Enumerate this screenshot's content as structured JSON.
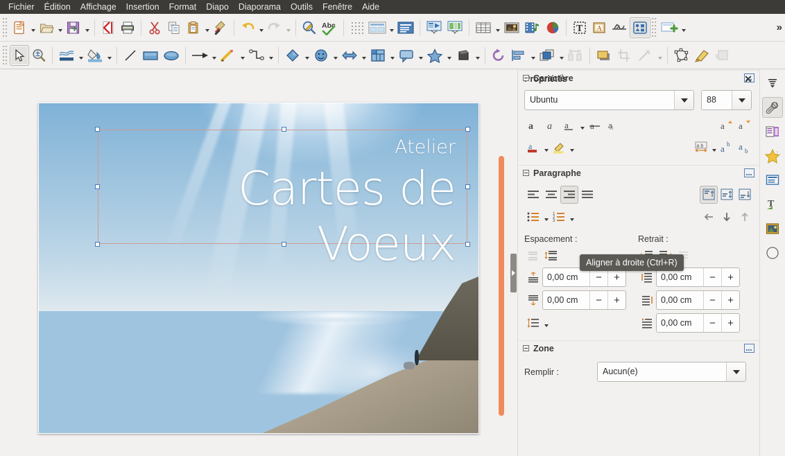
{
  "app": {
    "suite": "LibreOffice Impress"
  },
  "menubar": {
    "items": [
      {
        "label": "Fichier",
        "name": "menu-fichier"
      },
      {
        "label": "Édition",
        "name": "menu-edition"
      },
      {
        "label": "Affichage",
        "name": "menu-affichage"
      },
      {
        "label": "Insertion",
        "name": "menu-insertion"
      },
      {
        "label": "Format",
        "name": "menu-format"
      },
      {
        "label": "Diapo",
        "name": "menu-diapo"
      },
      {
        "label": "Diaporama",
        "name": "menu-diaporama"
      },
      {
        "label": "Outils",
        "name": "menu-outils"
      },
      {
        "label": "Fenêtre",
        "name": "menu-fenetre"
      },
      {
        "label": "Aide",
        "name": "menu-aide"
      }
    ]
  },
  "toolbar_standard": {
    "overflow_label": "»",
    "items": [
      "new-document-icon",
      "open-document-icon",
      "save-document-icon",
      "export-pdf-icon",
      "print-icon",
      "cut-icon",
      "copy-icon",
      "paste-icon",
      "clone-formatting-icon",
      "undo-icon",
      "redo-icon",
      "find-replace-icon",
      "spelling-icon",
      "display-grid-icon",
      "master-slide-icon",
      "slide-layout-icon",
      "start-from-first-slide-icon",
      "start-from-current-slide-icon",
      "insert-table-icon",
      "insert-image-icon",
      "insert-media-icon",
      "insert-chart-icon",
      "insert-text-box-icon",
      "insert-fontwork-icon",
      "insert-special-character-icon",
      "show-draw-functions-icon",
      "new-slide-icon"
    ]
  },
  "toolbar_drawing": {
    "items": [
      "select-icon",
      "zoom-icon",
      "line-color-icon",
      "fill-color-icon",
      "insert-line-icon",
      "rectangle-icon",
      "ellipse-icon",
      "line-ends-arrow-icon",
      "curves-and-polygons-icon",
      "connectors-icon",
      "basic-shapes-icon",
      "symbol-shapes-icon",
      "block-arrows-icon",
      "flowchart-shapes-icon",
      "callout-shapes-icon",
      "stars-shapes-icon",
      "3d-objects-icon",
      "rotate-icon",
      "align-objects-icon",
      "arrange-icon",
      "distribute-icon",
      "shadow-icon",
      "crop-image-icon",
      "filter-icon",
      "points-icon",
      "glue-points-icon",
      "to-curve-icon"
    ]
  },
  "slide": {
    "textbox": {
      "line1": "Atelier",
      "line2": "Cartes de Voeux",
      "alignment": "right",
      "selected": true
    },
    "background_image": "seascape-photo"
  },
  "sidebar": {
    "title": "Propriétés",
    "close_label": "✕",
    "sections": {
      "character": {
        "title": "Caractère",
        "font_name": "Ubuntu",
        "font_size": "88",
        "buttons": [
          "bold-icon",
          "italic-icon",
          "underline-icon",
          "strikethrough-icon",
          "shadow-icon",
          "increase-font-size-icon",
          "decrease-font-size-icon",
          "font-color-icon",
          "highlighting-color-icon",
          "character-spacing-icon",
          "superscript-icon",
          "subscript-icon"
        ]
      },
      "paragraph": {
        "title": "Paragraphe",
        "align_buttons": [
          "align-left-icon",
          "align-center-icon",
          "align-right-icon",
          "align-justified-icon"
        ],
        "align_selected": "align-right-icon",
        "vertical_buttons": [
          "align-top-icon",
          "center-vertically-icon",
          "align-bottom-icon"
        ],
        "list_buttons": [
          "unordered-list-icon",
          "ordered-list-icon",
          "demote-icon",
          "move-down-icon",
          "move-up-icon"
        ],
        "spacing_label": "Espacement :",
        "indent_label": "Retrait :",
        "spacing_above_value": "0,00 cm",
        "spacing_below_value": "0,00 cm",
        "indent_before_value": "0,00 cm",
        "indent_after_value": "0,00 cm",
        "indent_firstline_value": "0,00 cm",
        "minus_label": "−",
        "plus_label": "+"
      },
      "area": {
        "title": "Zone",
        "fill_label": "Remplir :",
        "fill_value": "Aucun(e)"
      }
    },
    "tabs": [
      {
        "name": "sidebar-settings-icon",
        "label": "Paramètres de la barre latérale",
        "selected": false
      },
      {
        "name": "sidebar-tab-properties-icon",
        "label": "Propriétés",
        "selected": true
      },
      {
        "name": "sidebar-tab-slide-transition-icon",
        "label": "Transition",
        "selected": false
      },
      {
        "name": "sidebar-tab-animation-icon",
        "label": "Animation",
        "selected": false
      },
      {
        "name": "sidebar-tab-master-slides-icon",
        "label": "Masques de diapos",
        "selected": false
      },
      {
        "name": "sidebar-tab-styles-icon",
        "label": "Styles",
        "selected": false
      },
      {
        "name": "sidebar-tab-gallery-icon",
        "label": "Galerie",
        "selected": false
      },
      {
        "name": "sidebar-tab-navigator-icon",
        "label": "Navigateur",
        "selected": false
      }
    ]
  },
  "tooltip": {
    "text": "Aligner à droite (Ctrl+R)"
  },
  "colors": {
    "menubar_bg": "#3c3b37",
    "toolbar_bg": "#f2f1f0",
    "scrollbar_thumb": "#f08b5a",
    "selection_handle": "#4879b8",
    "textbox_border": "#cf9a92",
    "tooltip_bg": "#5a5954"
  }
}
